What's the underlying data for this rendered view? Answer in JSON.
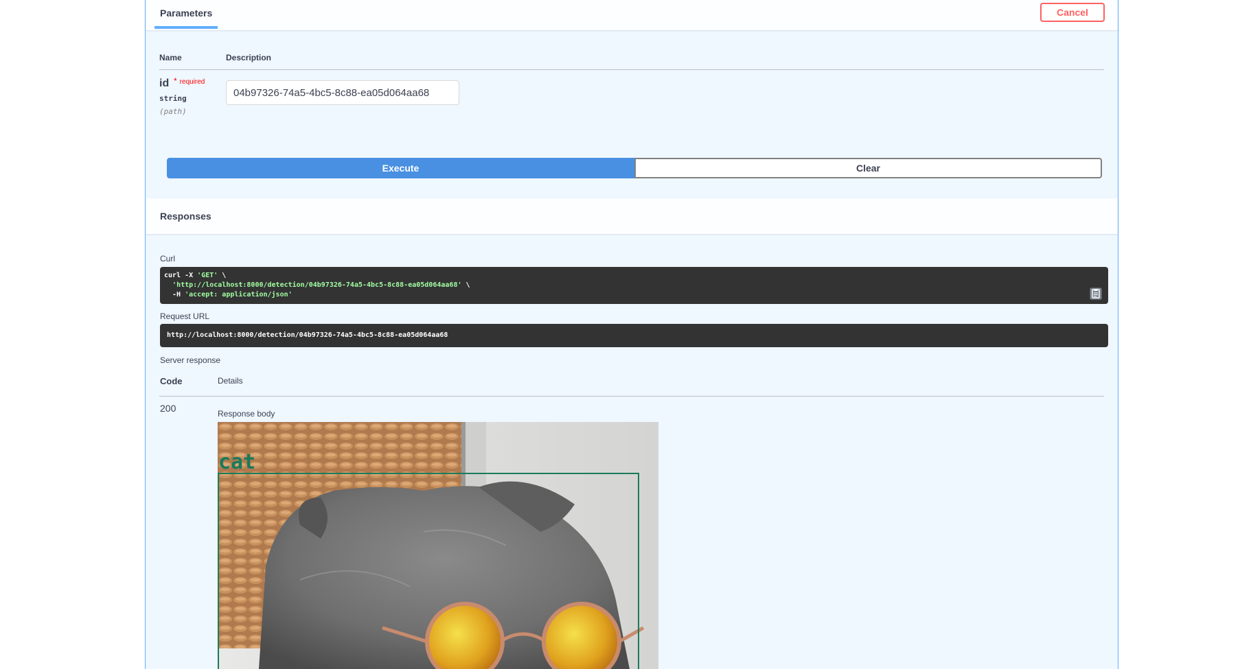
{
  "parameters": {
    "tab_label": "Parameters",
    "cancel_label": "Cancel",
    "col_name": "Name",
    "col_description": "Description",
    "param": {
      "name": "id",
      "required_star": "*",
      "required_label": "required",
      "type": "string",
      "location": "(path)",
      "value": "04b97326-74a5-4bc5-8c88-ea05d064aa68"
    },
    "execute_label": "Execute",
    "clear_label": "Clear"
  },
  "responses": {
    "title": "Responses",
    "curl_label": "Curl",
    "curl": {
      "line1_cmd": "curl -X ",
      "line1_method": "'GET'",
      "line1_end": " \\",
      "line2_url": "'http://localhost:8000/detection/04b97326-74a5-4bc5-8c88-ea05d064aa68'",
      "line2_end": " \\",
      "line3_flag": "  -H ",
      "line3_header": "'accept: application/json'"
    },
    "request_url_label": "Request URL",
    "request_url": "http://localhost:8000/detection/04b97326-74a5-4bc5-8c88-ea05d064aa68",
    "server_response_label": "Server response",
    "col_code": "Code",
    "col_details": "Details",
    "status_code": "200",
    "response_body_label": "Response body",
    "detection_label": "cat"
  },
  "colors": {
    "accent_blue": "#61affe",
    "execute_blue": "#4990e2",
    "cancel_red": "#ff6060",
    "code_bg": "#333333",
    "detection_box": "#1a7a5c"
  },
  "icons": [
    "copy-to-clipboard-icon"
  ]
}
